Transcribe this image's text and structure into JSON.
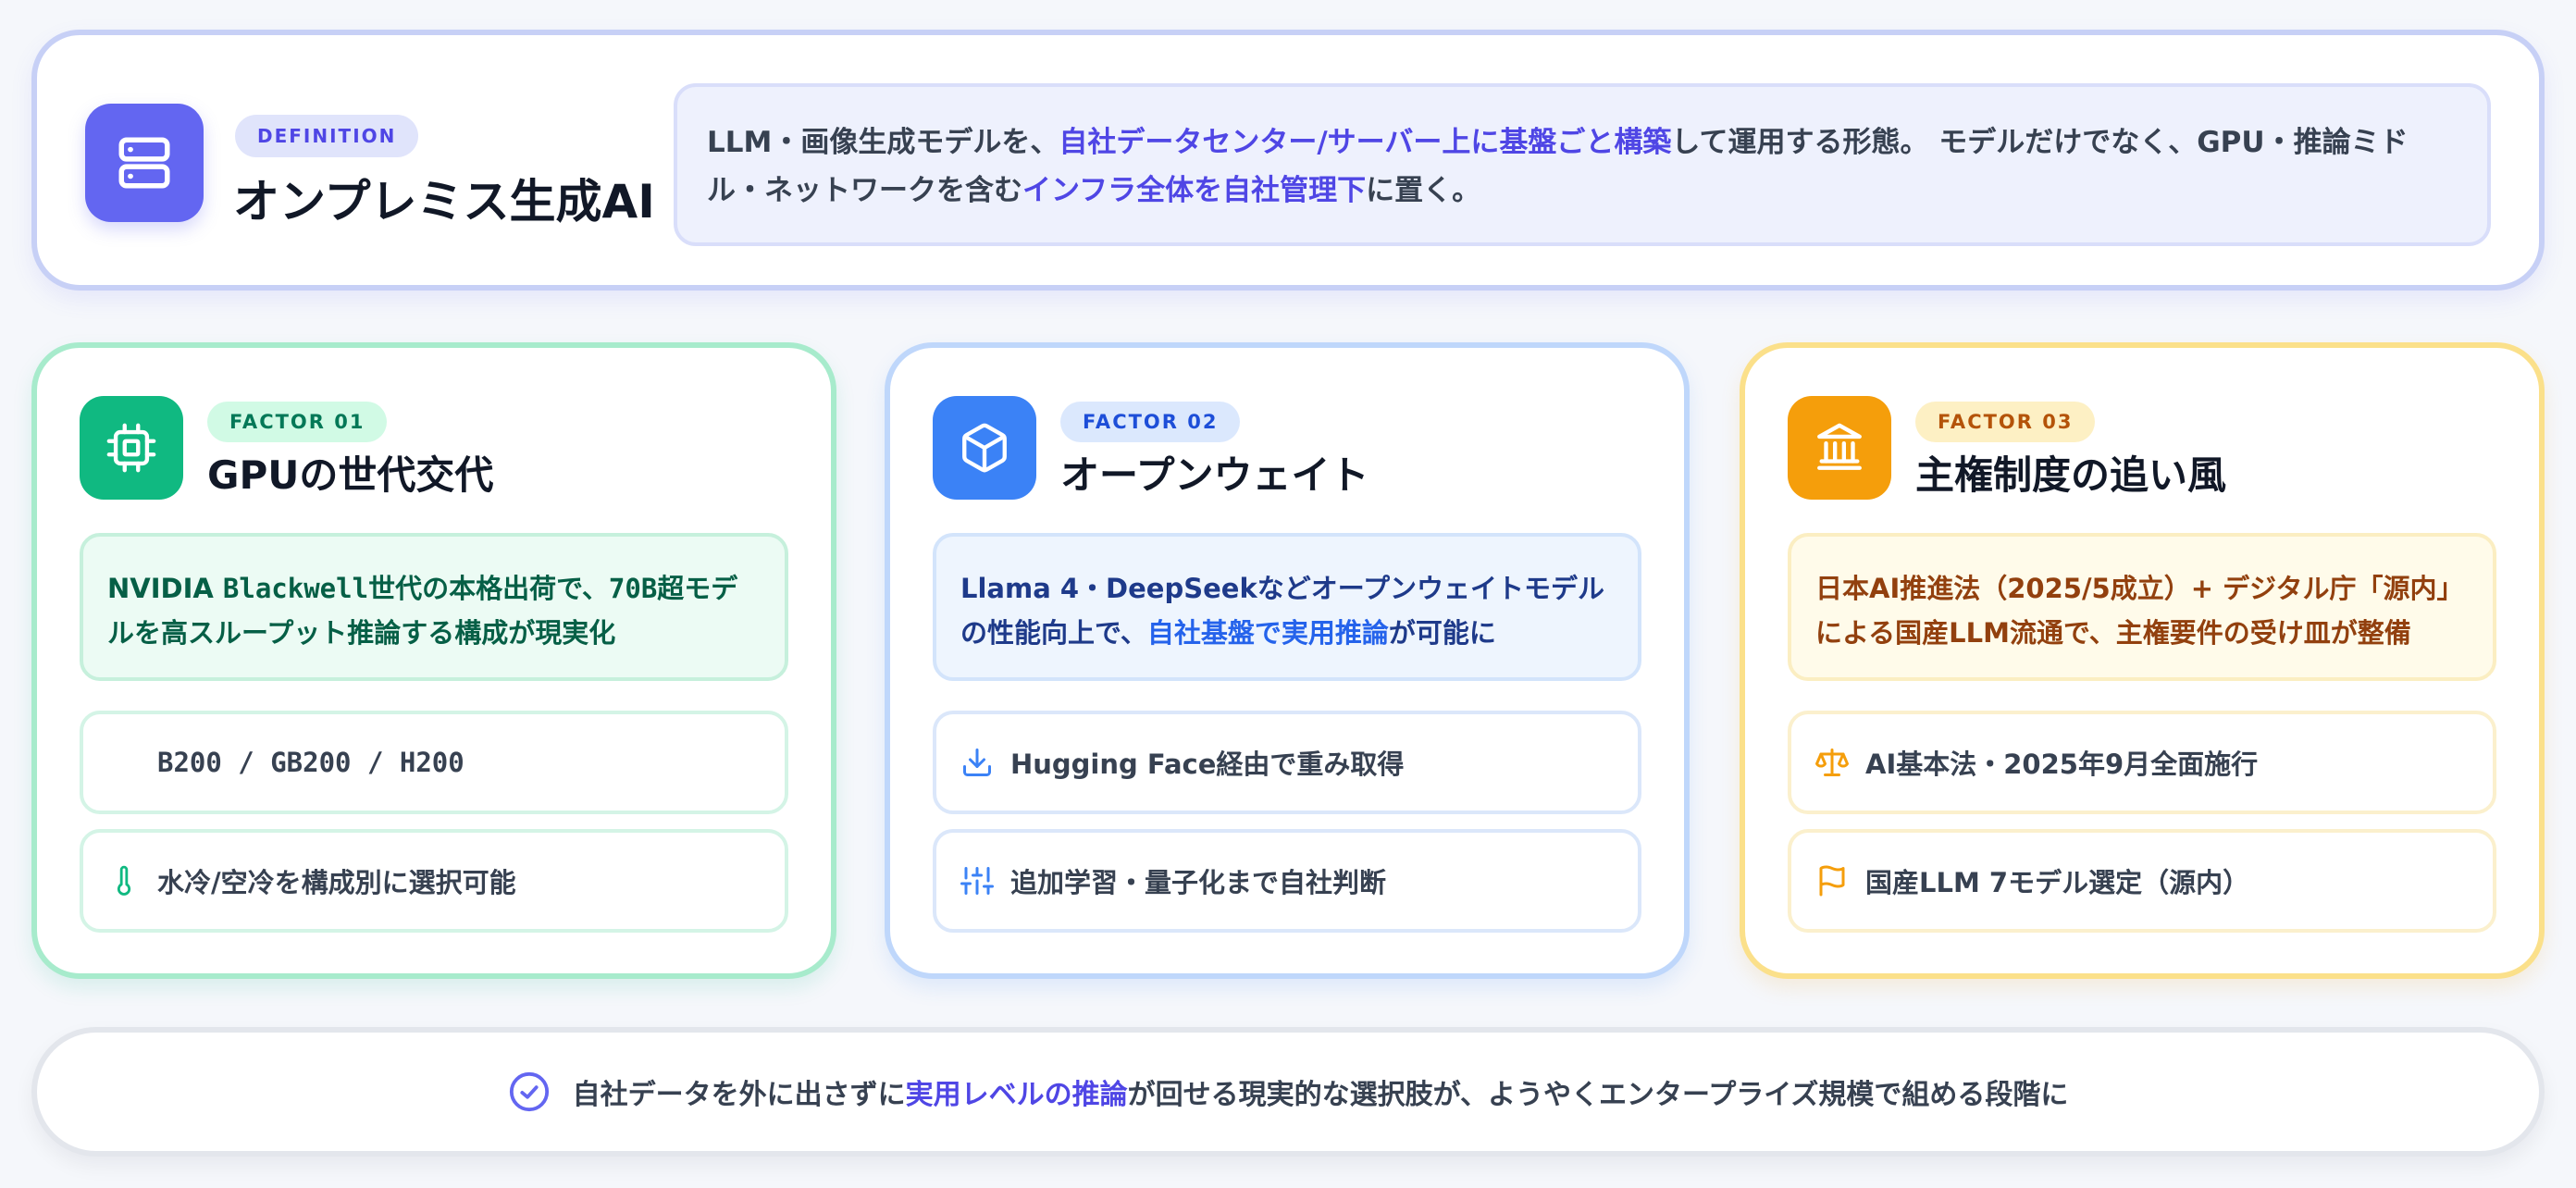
{
  "hero": {
    "badge": "DEFINITION",
    "title": "オンプレミス生成AI",
    "desc_1": "LLM・画像生成モデルを、",
    "desc_2": "自社データセンター/サーバー上に基盤ごと構築",
    "desc_3": "して運用する形態。 モデルだけでなく、GPU・推論ミドル・ネットワークを含む",
    "desc_4": "インフラ全体を自社管理下",
    "desc_5": "に置く。",
    "icon": "server-icon"
  },
  "cards": [
    {
      "badge": "FACTOR 01",
      "title": "GPUの世代交代",
      "icon": "chip-icon",
      "desc_prefix": "NVIDIA ",
      "desc_mono": "Blackwell",
      "desc_mid": "世代の本格出荷で、",
      "desc_mono2": "70B",
      "desc_rest": "超モデルを高スループット推論する構成が現実化",
      "items": [
        {
          "text": "B200 / GB200 / H200",
          "icon": ""
        },
        {
          "text": "水冷/空冷を構成別に選択可能",
          "icon": "thermometer-icon"
        }
      ]
    },
    {
      "badge": "FACTOR 02",
      "title": "オープンウェイト",
      "icon": "package-icon",
      "desc_1": "Llama 4・DeepSeekなどオープンウェイトモデルの性能向上で、",
      "desc_2": "自社基盤で実用推論",
      "desc_3": "が可能に",
      "items": [
        {
          "text": "Hugging Face経由で重み取得",
          "icon": "download-icon"
        },
        {
          "text": "追加学習・量子化まで自社判断",
          "icon": "sliders-icon"
        }
      ]
    },
    {
      "badge": "FACTOR 03",
      "title": "主権制度の追い風",
      "icon": "institution-icon",
      "desc": "日本AI推進法（2025/5成立）+ デジタル庁「源内」による国産LLM流通で、主権要件の受け皿が整備",
      "items": [
        {
          "text": "AI基本法・2025年9月全面施行",
          "icon": "scale-icon"
        },
        {
          "text": "国産LLM 7モデル選定（源内）",
          "icon": "flag-icon"
        }
      ]
    }
  ],
  "footer": {
    "icon": "check-circle-icon",
    "text_1": "自社データを外に出さずに",
    "text_2": "実用レベルの推論",
    "text_3": "が回せる現実的な選択肢が、ようやくエンタープライズ規模で組める段階に"
  },
  "colors": {
    "indigo": "#6366f1",
    "green": "#10b981",
    "blue": "#3b82f6",
    "amber": "#f59e0b"
  }
}
